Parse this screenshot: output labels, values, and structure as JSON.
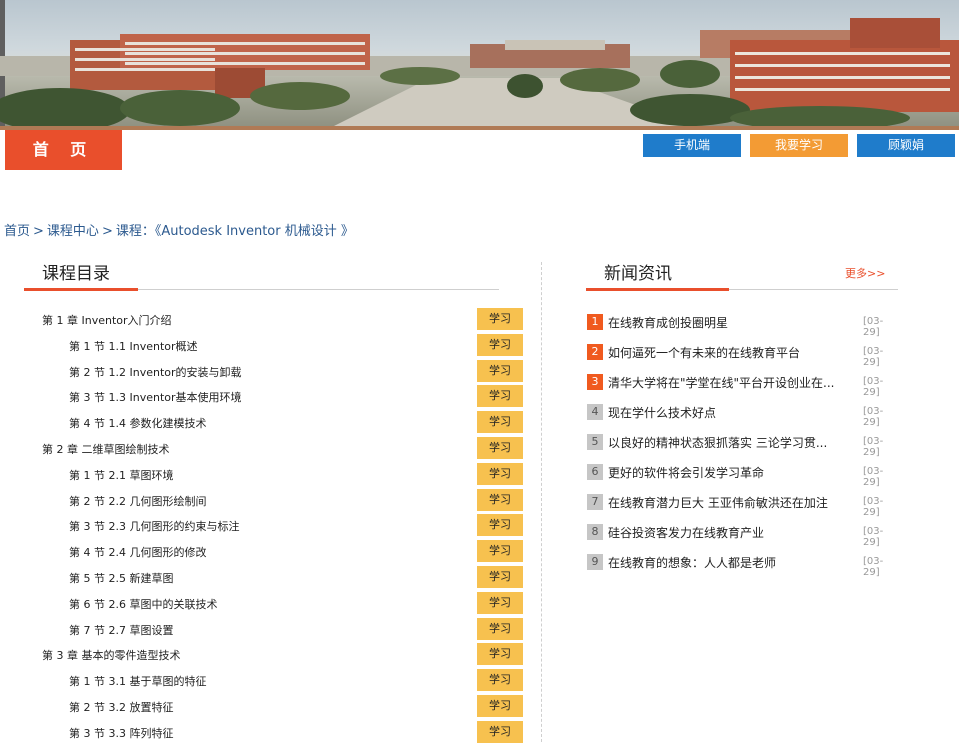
{
  "nav": {
    "home": "首 页",
    "buttons": [
      "手机端",
      "我要学习",
      "顾颖娟"
    ]
  },
  "breadcrumb": {
    "home": "首页",
    "center": "课程中心",
    "course": "课程：《Autodesk Inventor 机械设计 》"
  },
  "course": {
    "title": "课程目录",
    "study_label": "学习",
    "rows": [
      {
        "type": "chapter",
        "text": "第 1 章   Inventor入门介绍"
      },
      {
        "type": "section",
        "text": "第 1 节   1.1 Inventor概述"
      },
      {
        "type": "section",
        "text": "第 2 节   1.2 Inventor的安装与卸载"
      },
      {
        "type": "section",
        "text": "第 3 节   1.3 Inventor基本使用环境"
      },
      {
        "type": "section",
        "text": "第 4 节   1.4 参数化建模技术"
      },
      {
        "type": "chapter",
        "text": "第 2 章   二维草图绘制技术"
      },
      {
        "type": "section",
        "text": "第 1 节   2.1 草图环境"
      },
      {
        "type": "section",
        "text": "第 2 节   2.2 几何图形绘制间"
      },
      {
        "type": "section",
        "text": "第 3 节   2.3 几何图形的约束与标注"
      },
      {
        "type": "section",
        "text": "第 4 节   2.4 几何图形的修改"
      },
      {
        "type": "section",
        "text": "第 5 节   2.5 新建草图"
      },
      {
        "type": "section",
        "text": "第 6 节   2.6 草图中的关联技术"
      },
      {
        "type": "section",
        "text": "第 7 节   2.7 草图设置"
      },
      {
        "type": "chapter",
        "text": "第 3 章   基本的零件造型技术"
      },
      {
        "type": "section",
        "text": "第 1 节   3.1 基于草图的特征"
      },
      {
        "type": "section",
        "text": "第 2 节   3.2 放置特征"
      },
      {
        "type": "section",
        "text": "第 3 节   3.3 阵列特征"
      }
    ]
  },
  "news": {
    "title": "新闻资讯",
    "more": "更多>>",
    "items": [
      {
        "num": "1",
        "title": "在线教育成创投圈明星",
        "date": "[03-29]"
      },
      {
        "num": "2",
        "title": "如何逼死一个有未来的在线教育平台",
        "date": "[03-29]"
      },
      {
        "num": "3",
        "title": "清华大学将在\"学堂在线\"平台开设创业在...",
        "date": "[03-29]"
      },
      {
        "num": "4",
        "title": "现在学什么技术好点",
        "date": "[03-29]"
      },
      {
        "num": "5",
        "title": "以良好的精神状态狠抓落实 三论学习贯...",
        "date": "[03-29]"
      },
      {
        "num": "6",
        "title": "更好的软件将会引发学习革命",
        "date": "[03-29]"
      },
      {
        "num": "7",
        "title": "在线教育潜力巨大 王亚伟俞敏洪还在加注",
        "date": "[03-29]"
      },
      {
        "num": "8",
        "title": "硅谷投资客发力在线教育产业",
        "date": "[03-29]"
      },
      {
        "num": "9",
        "title": "在线教育的想象：人人都是老师",
        "date": "[03-29]"
      }
    ]
  },
  "colors": {
    "accent": "#e94f2c",
    "blue_button": "#1f7ccb",
    "orange_button": "#f39b34",
    "study_button": "#f7c14f",
    "hot_number": "#f05a1f",
    "cold_number": "#c6c6c6"
  }
}
